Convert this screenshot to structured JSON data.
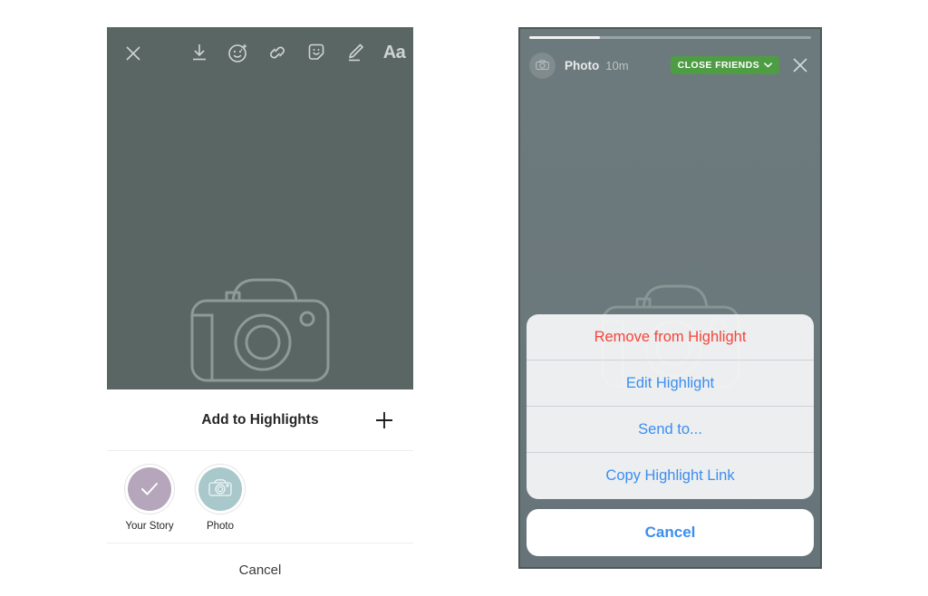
{
  "left_panel": {
    "toolbar": {
      "close_icon": "close-x-icon",
      "actions": [
        {
          "name": "save-download-icon",
          "label": "Save"
        },
        {
          "name": "face-sparkle-icon",
          "label": "Effects"
        },
        {
          "name": "link-icon",
          "label": "Link"
        },
        {
          "name": "sticker-icon",
          "label": "Sticker"
        },
        {
          "name": "draw-pen-icon",
          "label": "Draw"
        },
        {
          "name": "text-aa-icon",
          "label": "Aa"
        }
      ]
    },
    "canvas": {
      "placeholder_icon": "camera-icon",
      "background_color": "#5a6664"
    },
    "add_row": {
      "title": "Add to Highlights",
      "plus_icon": "plus-icon"
    },
    "highlights": [
      {
        "label": "Your Story",
        "icon": "check-icon",
        "fill_color": "#b5a6bb",
        "selected": true
      },
      {
        "label": "Photo",
        "icon": "camera-icon",
        "fill_color": "#a8c8cb",
        "selected": false
      }
    ],
    "cancel_label": "Cancel"
  },
  "right_panel": {
    "progress": {
      "percent": 25
    },
    "header": {
      "avatar_icon": "camera-avatar-icon",
      "name": "Photo",
      "time": "10m",
      "audience_badge": {
        "label": "CLOSE FRIENDS",
        "chevron_icon": "chevron-down-icon",
        "color": "#4e9c44"
      },
      "close_icon": "close-x-icon"
    },
    "canvas": {
      "placeholder_icon": "camera-icon"
    },
    "action_sheet": {
      "items": [
        {
          "label": "Remove from Highlight",
          "style": "destructive",
          "color": "#f4463c"
        },
        {
          "label": "Edit Highlight",
          "style": "normal",
          "color": "#3b8ef0"
        },
        {
          "label": "Send to...",
          "style": "normal",
          "color": "#3b8ef0"
        },
        {
          "label": "Copy Highlight Link",
          "style": "normal",
          "color": "#3b8ef0"
        }
      ],
      "cancel_label": "Cancel"
    }
  }
}
